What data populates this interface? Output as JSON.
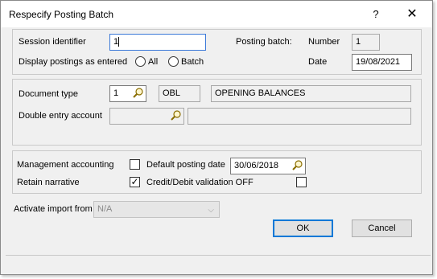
{
  "window": {
    "title": "Respecify Posting Batch",
    "help": "?",
    "close": "✕"
  },
  "session": {
    "identifier_label": "Session identifier",
    "identifier_value": "1",
    "display_label": "Display postings as entered",
    "option_all": "All",
    "option_batch": "Batch"
  },
  "posting_batch": {
    "label": "Posting batch:",
    "number_label": "Number",
    "number_value": "1",
    "date_label": "Date",
    "date_value": "19/08/2021"
  },
  "document": {
    "type_label": "Document type",
    "type_value": "1",
    "code": "OBL",
    "description": "OPENING BALANCES",
    "double_entry_label": "Double entry account",
    "double_entry_value": "",
    "double_entry_desc": ""
  },
  "options": {
    "management_label": "Management accounting",
    "management_checked": false,
    "default_date_label": "Default posting date",
    "default_date_value": "30/06/2018",
    "retain_label": "Retain narrative",
    "retain_checked": true,
    "credit_debit_label": "Credit/Debit validation OFF",
    "credit_debit_checked": false
  },
  "import": {
    "label": "Activate import from",
    "value": "N/A"
  },
  "buttons": {
    "ok": "OK",
    "cancel": "Cancel"
  },
  "icons": {
    "lookup": "magnifier-icon",
    "check": "✓",
    "dropdown": "chevron-down-icon"
  }
}
